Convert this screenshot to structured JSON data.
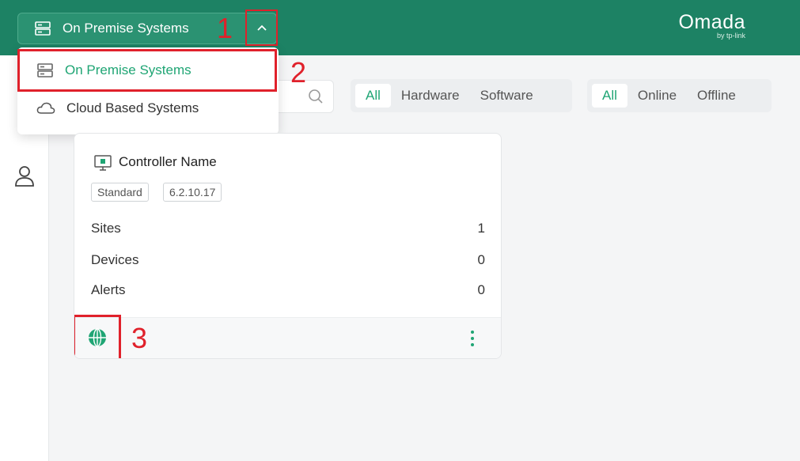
{
  "header": {
    "system_selector": "On Premise Systems",
    "brand_name": "Omada",
    "brand_sub": "by tp-link"
  },
  "annotations": {
    "step1": "1",
    "step2": "2",
    "step3": "3",
    "color": "#e0212b"
  },
  "dropdown": {
    "items": [
      {
        "label": "On Premise Systems",
        "icon": "server-icon",
        "selected": true
      },
      {
        "label": "Cloud Based Systems",
        "icon": "cloud-icon",
        "selected": false
      }
    ]
  },
  "filters": {
    "type": {
      "options": [
        "All",
        "Hardware",
        "Software"
      ],
      "selected": "All"
    },
    "status": {
      "options": [
        "All",
        "Online",
        "Offline"
      ],
      "selected": "All"
    }
  },
  "card": {
    "title": "Controller Name",
    "tags": [
      "Standard",
      "6.2.10.17"
    ],
    "stats": [
      {
        "label": "Sites",
        "value": "1"
      },
      {
        "label": "Devices",
        "value": "0"
      },
      {
        "label": "Alerts",
        "value": "0"
      }
    ]
  },
  "colors": {
    "header": "#1d8264",
    "accent": "#1fa574"
  }
}
